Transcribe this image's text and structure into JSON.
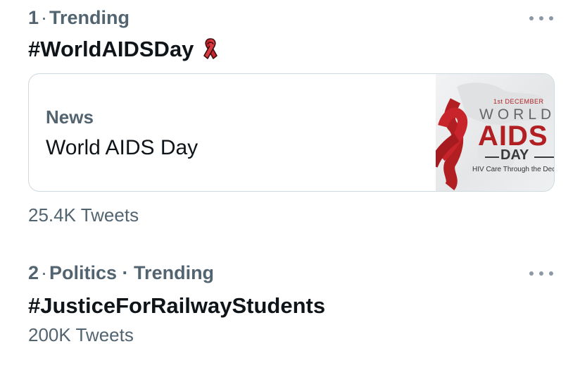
{
  "trends": [
    {
      "rank": "1",
      "separator": "·",
      "context": "Trending",
      "hashtag": "#WorldAIDSDay",
      "card": {
        "category": "News",
        "title": "World AIDS Day",
        "image": {
          "date": "1st DECEMBER",
          "word1": "WORLD",
          "word2": "AIDS",
          "word3": "DAY",
          "tagline": "HIV Care Through the Dec"
        }
      },
      "tweet_count": "25.4K Tweets"
    },
    {
      "rank": "2",
      "separator": "·",
      "context": "Politics · Trending",
      "hashtag": "#JusticeForRailwayStudents",
      "tweet_count": "200K Tweets"
    }
  ],
  "icons": {
    "more": "more-options-icon",
    "ribbon": "red-ribbon-icon"
  },
  "colors": {
    "secondary_text": "#536471",
    "primary_text": "#0f1419",
    "ribbon_red": "#c8242b",
    "border": "#cfd9de"
  }
}
